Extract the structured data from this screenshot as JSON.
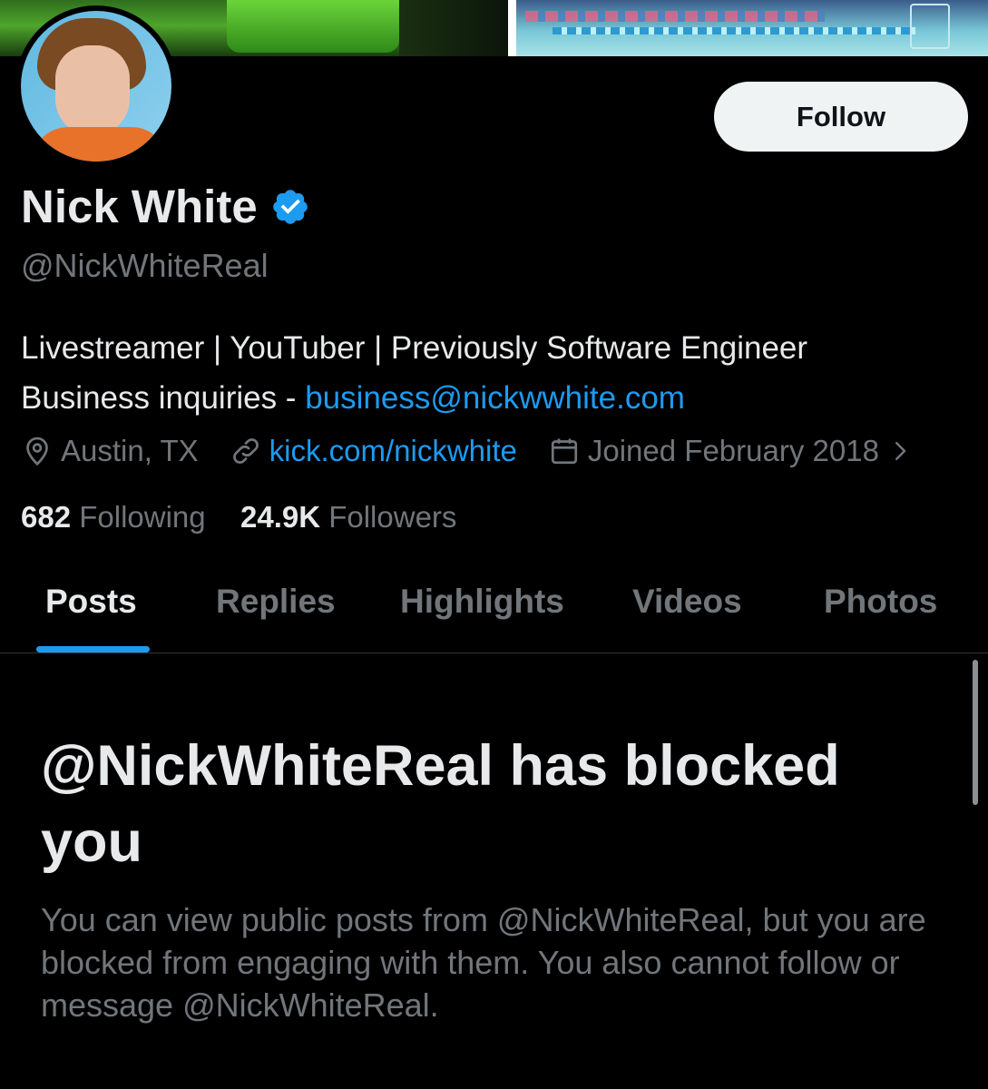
{
  "profile": {
    "name": "Nick White",
    "handle": "@NickWhiteReal",
    "bio_line1": "Livestreamer | YouTuber | Previously Software Engineer",
    "bio_line2_prefix": "Business inquiries - ",
    "bio_email": "business@nickwwhite.com",
    "location": "Austin, TX",
    "website": "kick.com/nickwhite",
    "joined": "Joined February 2018",
    "following_count": "682",
    "following_label": "Following",
    "followers_count": "24.9K",
    "followers_label": "Followers"
  },
  "actions": {
    "follow_label": "Follow"
  },
  "tabs": [
    {
      "label": "Posts",
      "active": true
    },
    {
      "label": "Replies",
      "active": false
    },
    {
      "label": "Highlights",
      "active": false
    },
    {
      "label": "Videos",
      "active": false
    },
    {
      "label": "Photos",
      "active": false
    }
  ],
  "blocked": {
    "title": "@NickWhiteReal has blocked you",
    "description": "You can view public posts from @NickWhiteReal, but you are blocked from engaging with them. You also cannot follow or message @NickWhiteReal."
  },
  "colors": {
    "background": "#000000",
    "accent": "#1d9bf0",
    "text_primary": "#e7e9ea",
    "text_secondary": "#71767b",
    "follow_button_bg": "#eff3f4"
  },
  "icons": {
    "verified": "verified-badge-icon",
    "location": "location-pin-icon",
    "website": "link-icon",
    "joined": "calendar-icon",
    "expand": "chevron-right-icon"
  }
}
